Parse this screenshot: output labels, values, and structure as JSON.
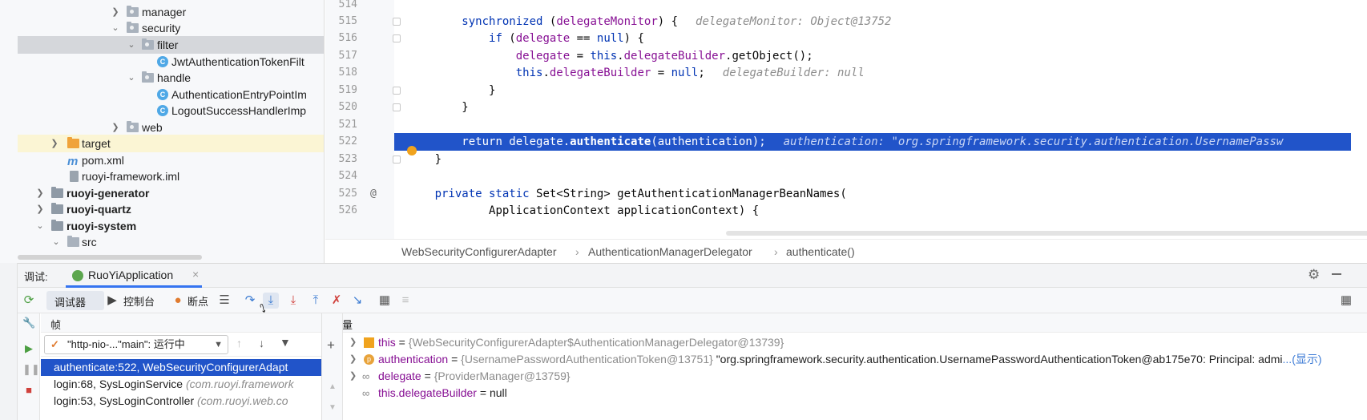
{
  "project_tree": {
    "rows": [
      {
        "label": "manager"
      },
      {
        "label": "security"
      },
      {
        "label": "filter"
      },
      {
        "label": "JwtAuthenticationTokenFilt"
      },
      {
        "label": "handle"
      },
      {
        "label": "AuthenticationEntryPointIm"
      },
      {
        "label": "LogoutSuccessHandlerImp"
      },
      {
        "label": "web"
      },
      {
        "label": "target"
      },
      {
        "label": "pom.xml"
      },
      {
        "label": "ruoyi-framework.iml"
      },
      {
        "label": "ruoyi-generator"
      },
      {
        "label": "ruoyi-quartz"
      },
      {
        "label": "ruoyi-system"
      },
      {
        "label": "src"
      }
    ]
  },
  "editor": {
    "line_numbers": [
      "514",
      "515",
      "516",
      "517",
      "518",
      "519",
      "520",
      "521",
      "522",
      "523",
      "524",
      "525",
      "526"
    ],
    "code": {
      "l515_kw": "synchronized",
      "l515_rest_a": " (",
      "l515_field": "delegateMonitor",
      "l515_rest_b": ") {",
      "l515_hint": "delegateMonitor: Object@13752",
      "l516_kw": "if",
      "l516_rest_a": " (",
      "l516_field": "delegate",
      "l516_rest_b": " == ",
      "l516_null": "null",
      "l516_rest_c": ") {",
      "l517_field": "delegate",
      "l517_rest_a": " = ",
      "l517_this": "this",
      "l517_dot": ".",
      "l517_field2": "delegateBuilder",
      "l517_rest_b": ".getObject();",
      "l518_this": "this",
      "l518_dot": ".",
      "l518_field": "delegateBuilder",
      "l518_rest_a": " = ",
      "l518_null": "null",
      "l518_rest_b": ";",
      "l518_hint": "delegateBuilder: null",
      "l519": "}",
      "l520": "}",
      "l522_kw": "return",
      "l522_a": " delegate.",
      "l522_method": "authenticate",
      "l522_b": "(authentication);",
      "l522_hint": "authentication: \"org.springframework.security.authentication.UsernamePassw",
      "l523": "}",
      "l525_kw": "private static",
      "l525_rest": " Set<String> getAuthenticationManagerBeanNames(",
      "l525_at": "@",
      "l526": "ApplicationContext applicationContext) {"
    },
    "breadcrumb": [
      "WebSecurityConfigurerAdapter",
      "AuthenticationManagerDelegator",
      "authenticate()"
    ],
    "breadcrumb_sep": "›"
  },
  "debug": {
    "header_label": "调试:",
    "run_config": "RuoYiApplication",
    "close_glyph": "×",
    "tabs": {
      "debugger": "调试器",
      "console": "控制台",
      "breakpoints": "断点"
    },
    "frames_title": "帧",
    "variables_title": "变量",
    "thread": "\"http-nio-...\"main\": 运行中",
    "frames": [
      {
        "method": "authenticate:522, WebSecurityConfigurerAdapt",
        "pkg": ""
      },
      {
        "method": "login:68, SysLoginService ",
        "pkg": "(com.ruoyi.framework"
      },
      {
        "method": "login:53, SysLoginController ",
        "pkg": "(com.ruoyi.web.co"
      }
    ],
    "variables": [
      {
        "name": "this",
        "eq": " = ",
        "type": "{WebSecurityConfigurerAdapter$AuthenticationManagerDelegator@13739}",
        "value": "",
        "link": ""
      },
      {
        "name": "authentication",
        "eq": " = ",
        "type": "{UsernamePasswordAuthenticationToken@13751} ",
        "value": "\"org.springframework.security.authentication.UsernamePasswordAuthenticationToken@ab175e70: Principal: admi",
        "link": "...(显示)"
      },
      {
        "name": "delegate",
        "eq": " = ",
        "type": "{ProviderManager@13759}",
        "value": "",
        "link": ""
      },
      {
        "name": "this.delegateBuilder",
        "eq": " = ",
        "type": "",
        "value": "null",
        "link": ""
      }
    ]
  },
  "colors": {
    "exec_line": "#2154c9",
    "keyword": "#0033b3",
    "field": "#871094",
    "breakpoint": "#f0a31e"
  }
}
